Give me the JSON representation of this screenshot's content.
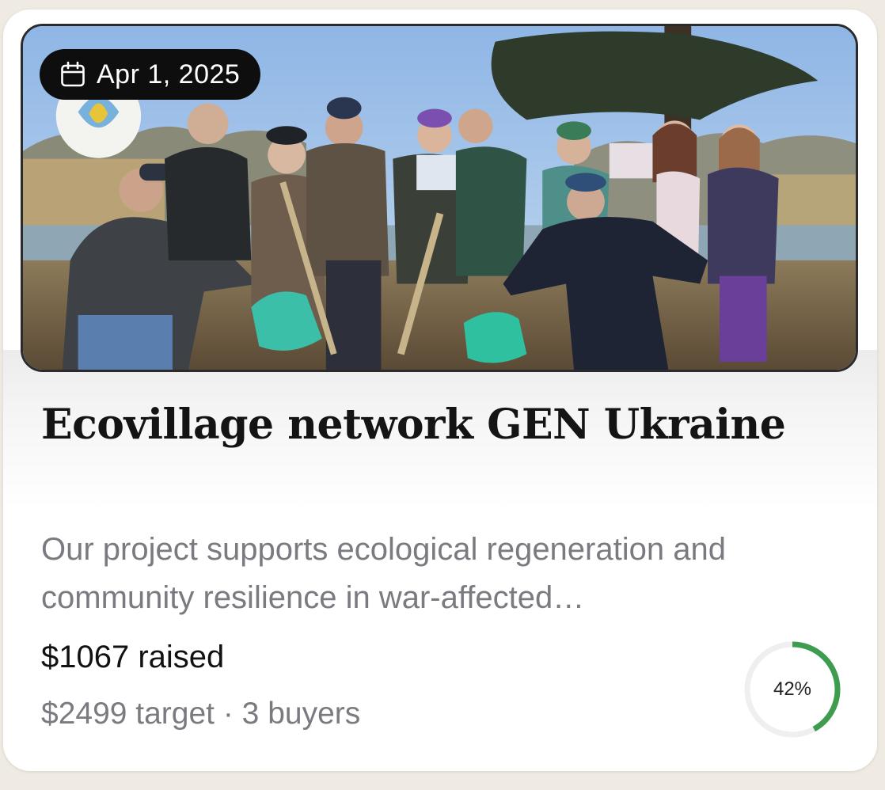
{
  "card": {
    "date": "Apr 1, 2025",
    "date_icon": "calendar-icon",
    "title": "Ecovillage network GEN Ukraine",
    "description": "Our project supports ecological regeneration and community resilience in war-affected…",
    "raised": "$1067 raised",
    "meta": "$2499 target · 3 buyers",
    "progress": {
      "percent_label": "42%",
      "fraction": 0.42,
      "color": "#3e9c4f",
      "track_color": "#efefef"
    }
  }
}
